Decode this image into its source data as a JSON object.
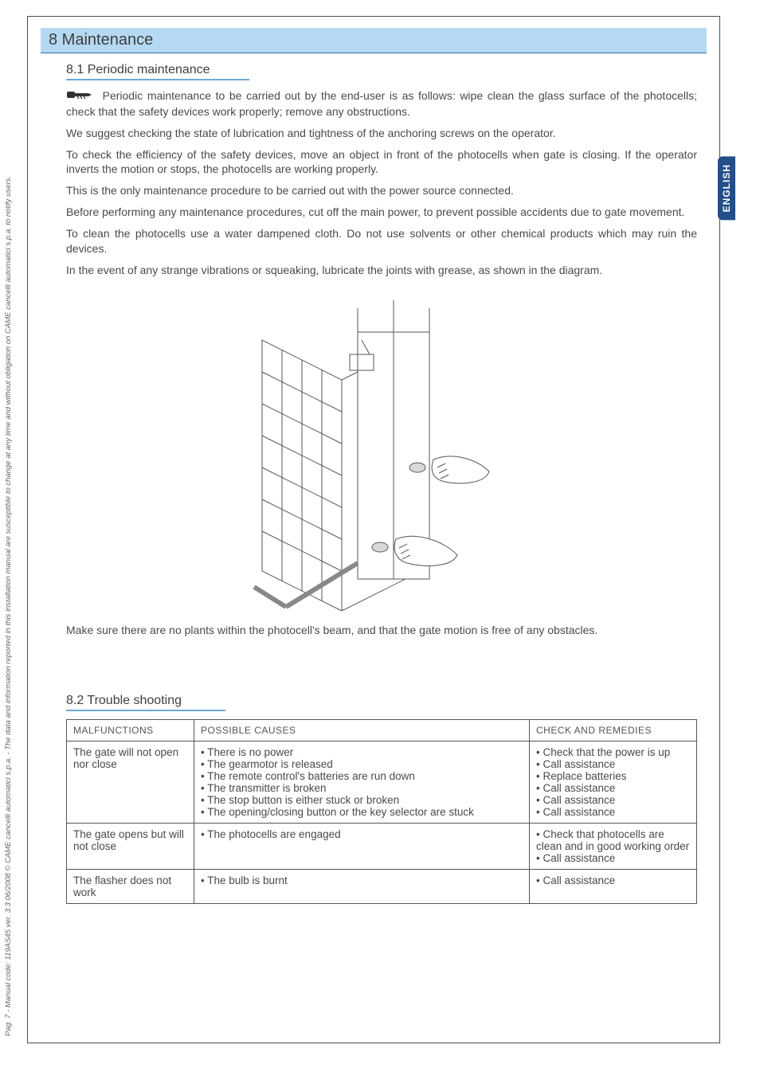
{
  "language_tab": "ENGLISH",
  "footer": "Pag. 7 - Manual code: 119AS45 ver. 3.3  06/2008 © CAME cancelli automatici s.p.a. - The data and information reported in this installation manual are susceptible to change at any time and without obligation on CAME cancelli automatici s.p.a. to notify users.",
  "section": {
    "number_title": "8 Maintenance",
    "sub1": {
      "title": "8.1 Periodic maintenance",
      "paragraphs": [
        "Periodic maintenance to be carried out by the end-user is as follows: wipe clean the glass surface of the photocells; check that the safety devices work properly; remove any obstructions.",
        "We suggest checking the state of lubrication and tightness of the anchoring screws on the operator.",
        "To check the efficiency of the safety devices, move an object in front of the photocells when gate is closing. If the operator inverts the motion or stops, the photocells are working properly.",
        "This is the only maintenance procedure to be carried out with the power source connected.",
        "Before performing any maintenance procedures, cut off the main power, to prevent possible accidents due to gate movement.",
        "To clean the photocells use a water dampened cloth. Do not use solvents or other chemical products which may ruin the devices.",
        "In the event of any strange vibrations or squeaking, lubricate the joints with grease, as shown in the diagram."
      ],
      "after_diagram": "Make sure there are no plants within the photocell's beam, and that the gate motion is free of any obstacles."
    },
    "sub2": {
      "title": "8.2 Trouble shooting",
      "table": {
        "headers": [
          "MALFUNCTIONS",
          "POSSIBLE CAUSES",
          "CHECK AND REMEDIES"
        ],
        "rows": [
          {
            "malfunction": "The gate will not open nor close",
            "causes": "• There is no power\n• The gearmotor is released\n• The remote control's batteries are run down\n• The transmitter is broken\n• The stop button is either stuck or broken\n• The opening/closing button  or the key selector are stuck",
            "remedies": "• Check that the power is up\n• Call assistance\n• Replace batteries\n• Call assistance\n• Call assistance\n• Call assistance"
          },
          {
            "malfunction": "The gate opens but will not close",
            "causes": "• The photocells are engaged",
            "remedies": "• Check that photocells are clean and in good working order\n• Call assistance"
          },
          {
            "malfunction": "The flasher does not work",
            "causes": "• The bulb is burnt",
            "remedies": "• Call assistance"
          }
        ]
      }
    }
  }
}
